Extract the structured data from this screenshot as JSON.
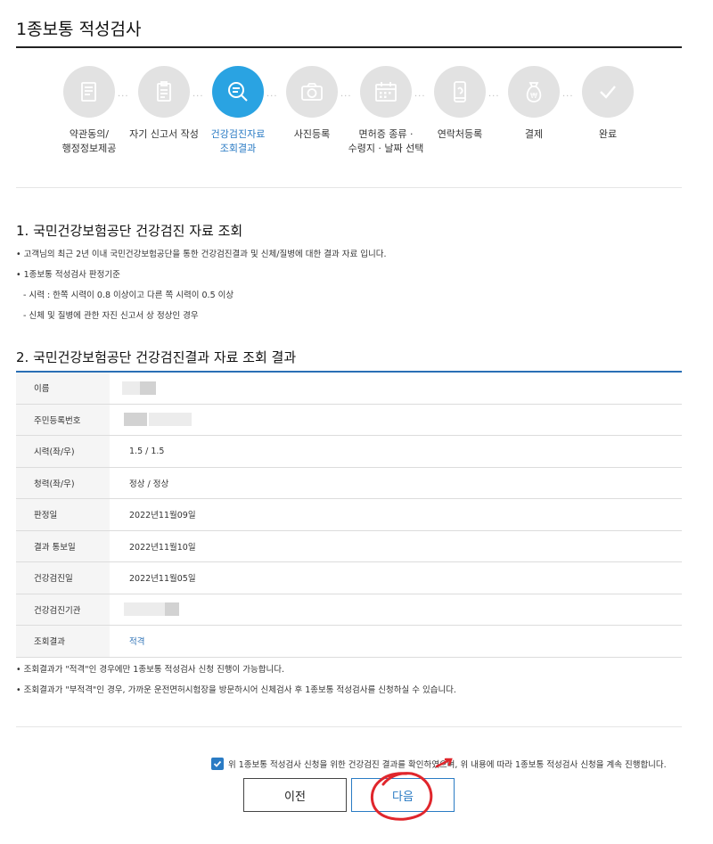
{
  "page_title": "1종보통 적성검사",
  "steps": [
    {
      "label": "약관동의/\n행정정보제공",
      "icon": "document-icon",
      "active": false
    },
    {
      "label": "자기 신고서 작성",
      "icon": "clipboard-icon",
      "active": false
    },
    {
      "label": "건강검진자료\n조회결과",
      "icon": "search-list-icon",
      "active": true
    },
    {
      "label": "사진등록",
      "icon": "camera-icon",
      "active": false
    },
    {
      "label": "면허증 종류 ·\n수령지 · 날짜 선택",
      "icon": "calendar-icon",
      "active": false
    },
    {
      "label": "연락처등록",
      "icon": "phone-icon",
      "active": false
    },
    {
      "label": "결제",
      "icon": "money-bag-icon",
      "active": false
    },
    {
      "label": "완료",
      "icon": "check-icon",
      "active": false
    }
  ],
  "section1": {
    "heading": "1. 국민건강보험공단 건강검진 자료 조회",
    "bullet1": "고객님의 최근 2년 이내 국민건강보험공단을 통한 건강검진결과 및 신체/질병에 대한 결과 자료 입니다.",
    "bullet2": "1종보통 적성검사 판정기준",
    "sub1": "- 시력 : 한쪽 시력이 0.8 이상이고 다른 쪽 시력이 0.5 이상",
    "sub2": "- 신체 및 질병에 관한 자진 신고서 상 정상인 경우"
  },
  "section2": {
    "heading": "2. 국민건강보험공단 건강검진결과 자료 조회 결과",
    "rows": [
      {
        "label": "이름",
        "value": ""
      },
      {
        "label": "주민등록번호",
        "value": ""
      },
      {
        "label": "시력(좌/우)",
        "value": "1.5 / 1.5"
      },
      {
        "label": "청력(좌/우)",
        "value": "정상 / 정상"
      },
      {
        "label": "판정일",
        "value": "2022년11월09일"
      },
      {
        "label": "결과 통보일",
        "value": "2022년11월10일"
      },
      {
        "label": "건강검진일",
        "value": "2022년11월05일"
      },
      {
        "label": "건강검진기관",
        "value": ""
      },
      {
        "label": "조회결과",
        "value": "적격"
      }
    ],
    "note1": "조회결과가 \"적격\"인 경우에만 1종보통 적성검사 신청 진행이 가능합니다.",
    "note2": "조회결과가 \"부적격\"인 경우, 가까운 운전면허시험장을 방문하시어 신체검사 후 1종보통 적성검사를 신청하실 수 있습니다."
  },
  "agreement": {
    "checked": true,
    "text": "위 1종보통 적성검사 신청을 위한 건강검진 결과를 확인하였으며, 위 내용에 따라 1종보통 적성검사 신청을 계속 진행합니다."
  },
  "buttons": {
    "prev": "이전",
    "next": "다음"
  },
  "colors": {
    "accent": "#2a7bc4",
    "active_step": "#2aa3e2",
    "inactive_step": "#e2e2e2",
    "annotation": "#e0262c"
  }
}
